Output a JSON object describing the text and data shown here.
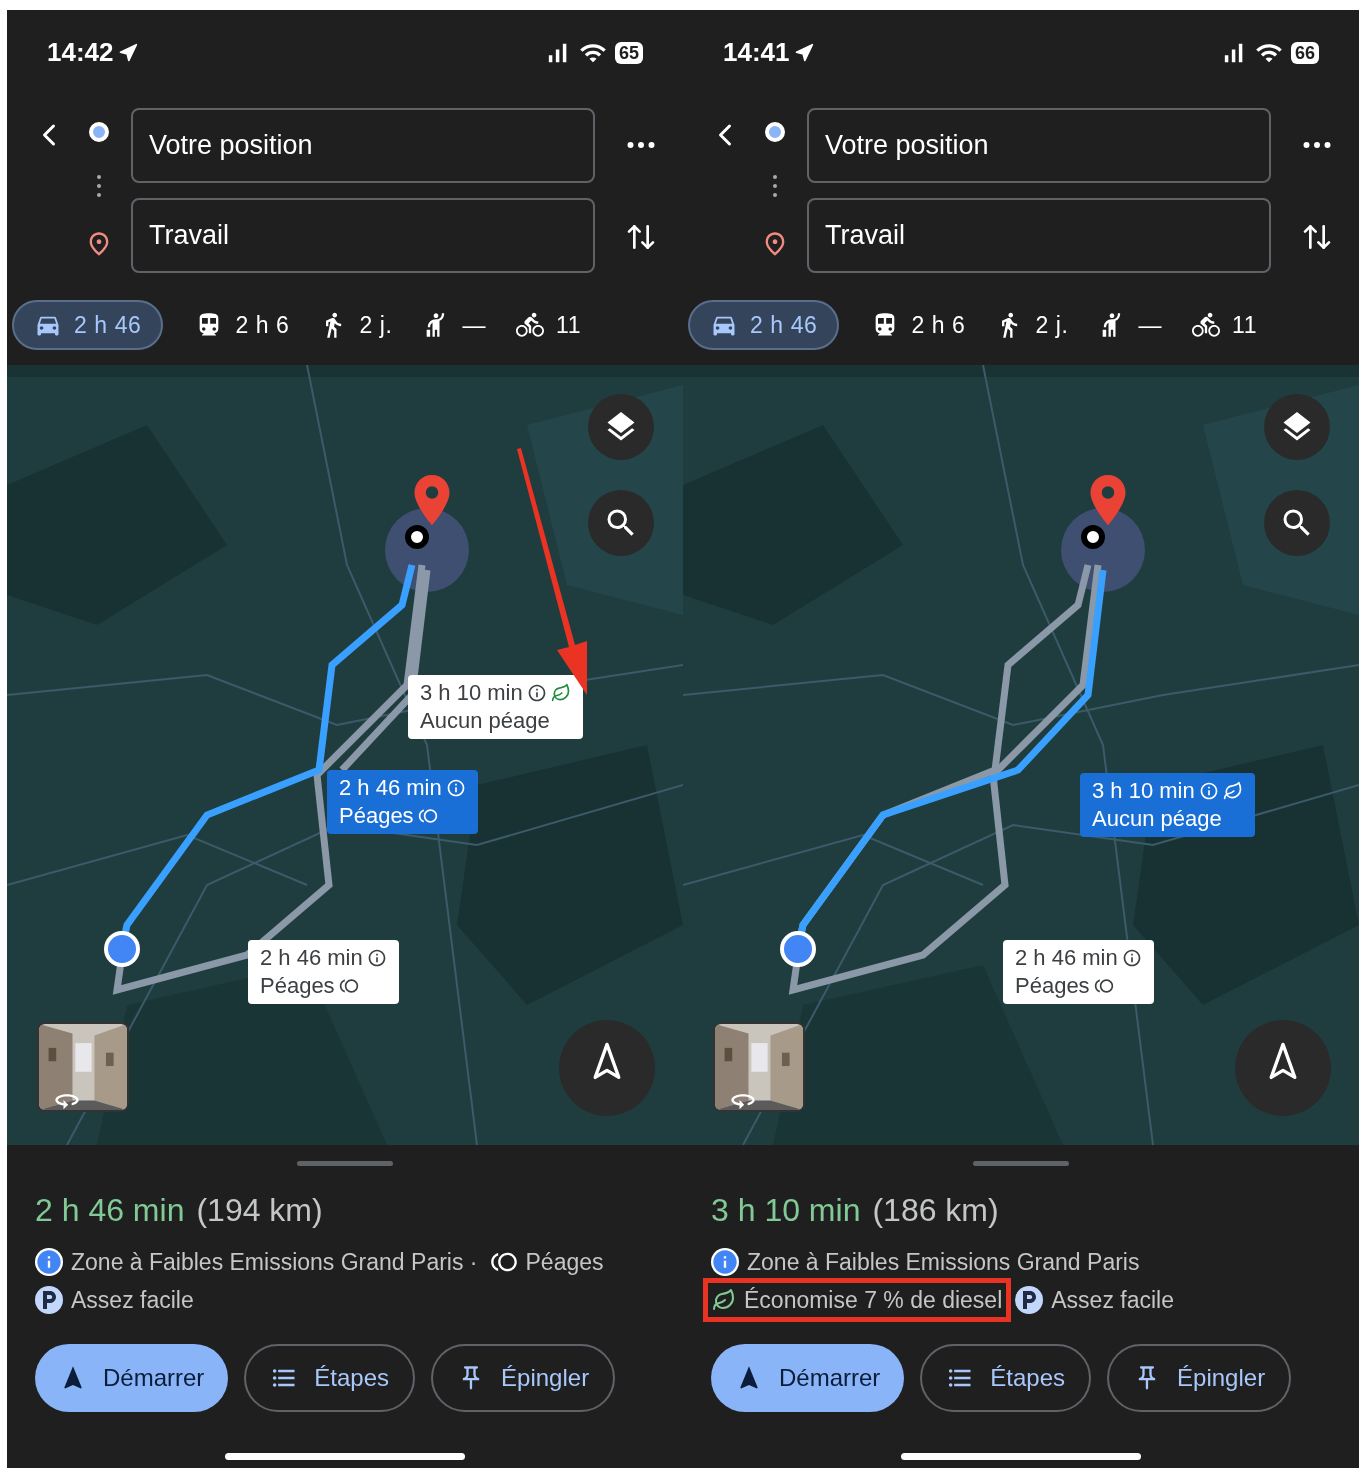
{
  "phones": [
    {
      "status": {
        "time": "14:42",
        "battery": "65"
      },
      "origin": {
        "value": "Votre position"
      },
      "destination": {
        "value": "Travail"
      },
      "modes": [
        {
          "kind": "car",
          "label": "2 h 46",
          "selected": true
        },
        {
          "kind": "transit",
          "label": "2 h 6",
          "selected": false
        },
        {
          "kind": "walk",
          "label": "2 j.",
          "selected": false
        },
        {
          "kind": "ride",
          "label": "—",
          "selected": false
        },
        {
          "kind": "bike",
          "label": "11",
          "selected": false
        }
      ],
      "map": {
        "arrow": true,
        "routes": [
          {
            "duration": "3 h 10 min",
            "note": "Aucun péage",
            "selected": false,
            "eco": true,
            "tolls": false
          },
          {
            "duration": "2 h 46 min",
            "note": "Péages",
            "selected": true,
            "eco": false,
            "tolls": true
          },
          {
            "duration": "2 h 46 min",
            "note": "Péages",
            "selected": false,
            "eco": false,
            "tolls": true
          }
        ]
      },
      "summary": {
        "duration": "2 h 46 min",
        "distance": "(194 km)",
        "lines": [
          [
            {
              "kind": "info",
              "text": "Zone à Faibles Emissions Grand Paris ·",
              "highlighted": false
            },
            {
              "kind": "toll",
              "text": "Péages",
              "highlighted": false
            }
          ],
          [
            {
              "kind": "parking",
              "text": "Assez facile",
              "highlighted": false
            }
          ]
        ]
      },
      "buttons": [
        {
          "kind": "start",
          "label": "Démarrer"
        },
        {
          "kind": "steps",
          "label": "Étapes"
        },
        {
          "kind": "pin",
          "label": "Épingler"
        }
      ]
    },
    {
      "status": {
        "time": "14:41",
        "battery": "66"
      },
      "origin": {
        "value": "Votre position"
      },
      "destination": {
        "value": "Travail"
      },
      "modes": [
        {
          "kind": "car",
          "label": "2 h 46",
          "selected": true
        },
        {
          "kind": "transit",
          "label": "2 h 6",
          "selected": false
        },
        {
          "kind": "walk",
          "label": "2 j.",
          "selected": false
        },
        {
          "kind": "ride",
          "label": "—",
          "selected": false
        },
        {
          "kind": "bike",
          "label": "11",
          "selected": false
        }
      ],
      "map": {
        "routes": [
          {
            "duration": "3 h 10 min",
            "note": "Aucun péage",
            "selected": true,
            "eco": true,
            "tolls": false
          },
          {
            "duration": "2 h 46 min",
            "note": "Péages",
            "selected": false,
            "eco": false,
            "tolls": true
          }
        ]
      },
      "summary": {
        "duration": "3 h 10 min",
        "distance": "(186 km)",
        "lines": [
          [
            {
              "kind": "info",
              "text": "Zone à Faibles Emissions Grand Paris",
              "highlighted": false
            }
          ],
          [
            {
              "kind": "eco",
              "text": "Économise 7 % de diesel",
              "highlighted": true
            },
            {
              "kind": "parking",
              "text": "Assez facile",
              "highlighted": false
            }
          ]
        ]
      },
      "buttons": [
        {
          "kind": "start",
          "label": "Démarrer"
        },
        {
          "kind": "steps",
          "label": "Étapes"
        },
        {
          "kind": "pin",
          "label": "Épingler"
        }
      ]
    }
  ]
}
